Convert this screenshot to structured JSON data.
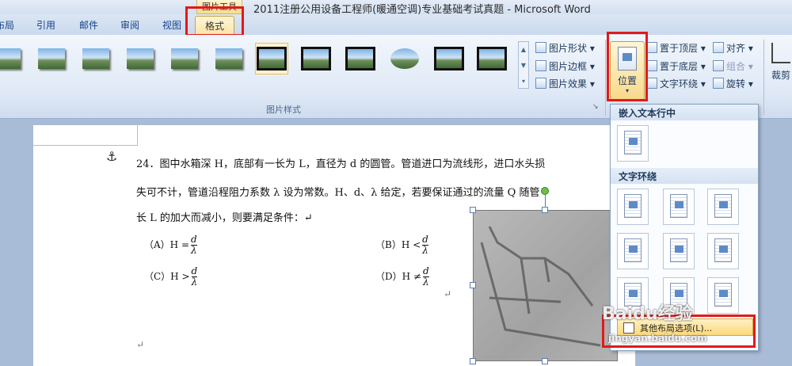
{
  "window": {
    "context_tab": "图片工具",
    "title": "2011注册公用设备工程师(暖通空调)专业基础考试真题 - Microsoft Word"
  },
  "tabs": [
    "布局",
    "引用",
    "邮件",
    "审阅",
    "视图",
    "格式"
  ],
  "ribbon": {
    "picture_shape": "图片形状",
    "picture_border": "图片边框",
    "picture_effects": "图片效果",
    "group_label": "图片样式",
    "position": "位置",
    "bring_front": "置于顶层",
    "send_back": "置于底层",
    "text_wrap": "文字环绕",
    "align": "对齐",
    "group": "组合",
    "rotate": "旋转",
    "crop": "裁剪"
  },
  "document": {
    "anchor": "⚓",
    "line1": "24．图中水箱深 H，底部有一长为 L，直径为 d 的圆管。管道进口为流线形，进口水头损",
    "line2": "失可不计，管道沿程阻力系数 λ 设为常数。H、d、λ 给定，若要保证通过的流量 Q 随管",
    "line3": "长 L 的加大而减小，则要满足条件：↵",
    "optA": "（A）H =",
    "optB": "（B）H <",
    "optC": "（C）H >",
    "optD": "（D）H ≠",
    "frac_num": "d",
    "frac_den": "λ",
    "return_mark": "↵"
  },
  "menu": {
    "inline_header": "嵌入文本行中",
    "wrap_header": "文字环绕",
    "more_options": "其他布局选项(L)..."
  },
  "watermark": {
    "logo": "Baidu经验",
    "url": "jingyan.baidu.com"
  }
}
